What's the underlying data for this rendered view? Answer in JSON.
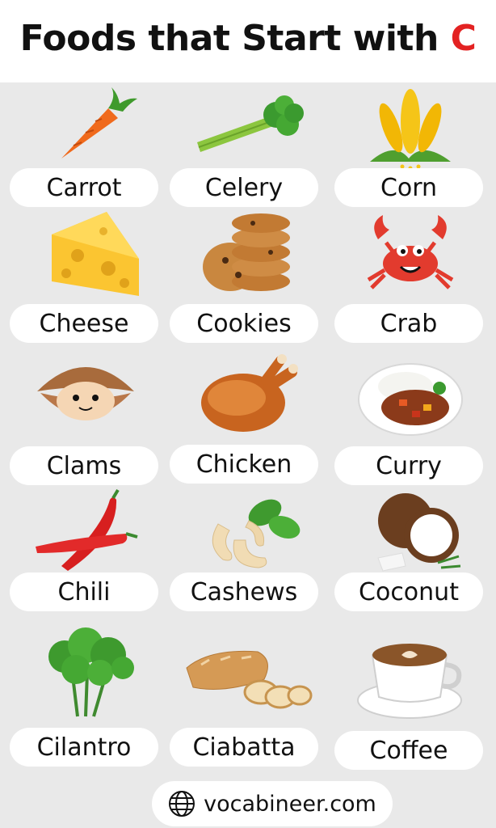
{
  "header": {
    "title_prefix": "Foods that Start with",
    "title_letter": "C"
  },
  "foods": [
    {
      "label": "Carrot",
      "icon": "carrot-icon"
    },
    {
      "label": "Celery",
      "icon": "celery-icon"
    },
    {
      "label": "Corn",
      "icon": "corn-icon"
    },
    {
      "label": "Cheese",
      "icon": "cheese-icon"
    },
    {
      "label": "Cookies",
      "icon": "cookies-icon"
    },
    {
      "label": "Crab",
      "icon": "crab-icon"
    },
    {
      "label": "Clams",
      "icon": "clam-icon"
    },
    {
      "label": "Chicken",
      "icon": "chicken-icon"
    },
    {
      "label": "Curry",
      "icon": "curry-icon"
    },
    {
      "label": "Chili",
      "icon": "chili-icon"
    },
    {
      "label": "Cashews",
      "icon": "cashew-icon"
    },
    {
      "label": "Coconut",
      "icon": "coconut-icon"
    },
    {
      "label": "Cilantro",
      "icon": "cilantro-icon"
    },
    {
      "label": "Ciabatta",
      "icon": "ciabatta-icon"
    },
    {
      "label": "Coffee",
      "icon": "coffee-icon"
    }
  ],
  "footer": {
    "site": "vocabineer.com",
    "icon": "globe-icon"
  },
  "colors": {
    "background": "#e9e9e9",
    "accent": "#e32222"
  }
}
